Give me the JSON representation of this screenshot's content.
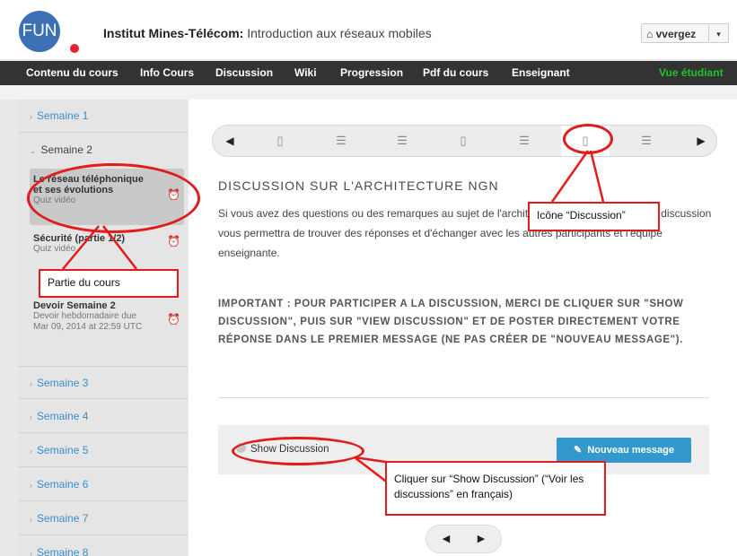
{
  "header": {
    "logo_text": "FUN",
    "institution": "Institut Mines-Télécom:",
    "course": " Introduction aux réseaux mobiles",
    "user": "vvergez"
  },
  "nav": [
    "Contenu du cours",
    "Info Cours",
    "Discussion",
    "Wiki",
    "Progression",
    "Pdf du cours",
    "Enseignant"
  ],
  "nav_right": "Vue étudiant",
  "sidebar": {
    "week1": "Semaine 1",
    "week2": "Semaine 2",
    "lessons": [
      {
        "title": "Le réseau téléphonique et ses évolutions",
        "subtitle": "Quiz vidéo"
      },
      {
        "title": "Sécurité (partie 1/2)",
        "subtitle": "Quiz vidéo"
      },
      {
        "title": "Devoir Semaine 2",
        "subtitle": "Devoir hebdomadaire due Mar 09, 2014 at 22:59 UTC"
      }
    ],
    "weeks_rest": [
      "Semaine 3",
      "Semaine 4",
      "Semaine 5",
      "Semaine 6",
      "Semaine 7",
      "Semaine 8"
    ]
  },
  "unit": {
    "title": "DISCUSSION SUR L'ARCHITECTURE NGN",
    "paragraph": "Si vous avez des questions ou des remarques au sujet de l'architecture NGN, cet espace de discussion vous permettra de trouver des réponses et d'échanger avec les autres participants et l'équipe enseignante.",
    "important": "IMPORTANT : POUR PARTICIPER A LA DISCUSSION, MERCI DE CLIQUER SUR \"SHOW DISCUSSION\", PUIS SUR \"VIEW DISCUSSION\" ET DE POSTER DIRECTEMENT VOTRE RÉPONSE DANS LE PREMIER MESSAGE (NE PAS CRÉER DE \"NOUVEAU MESSAGE\")."
  },
  "discussion": {
    "show": "Show Discussion",
    "new_message": "Nouveau message"
  },
  "annotations": {
    "icone_discussion": "Icône “Discussion”",
    "partie_cours": "Partie du cours",
    "cliquer": "Cliquer sur “Show Discussion” (“Voir les discussions” en français)"
  },
  "colors": {
    "annotation": "#e21b1b",
    "accent": "#3399cc",
    "nav_bg": "#333333"
  }
}
